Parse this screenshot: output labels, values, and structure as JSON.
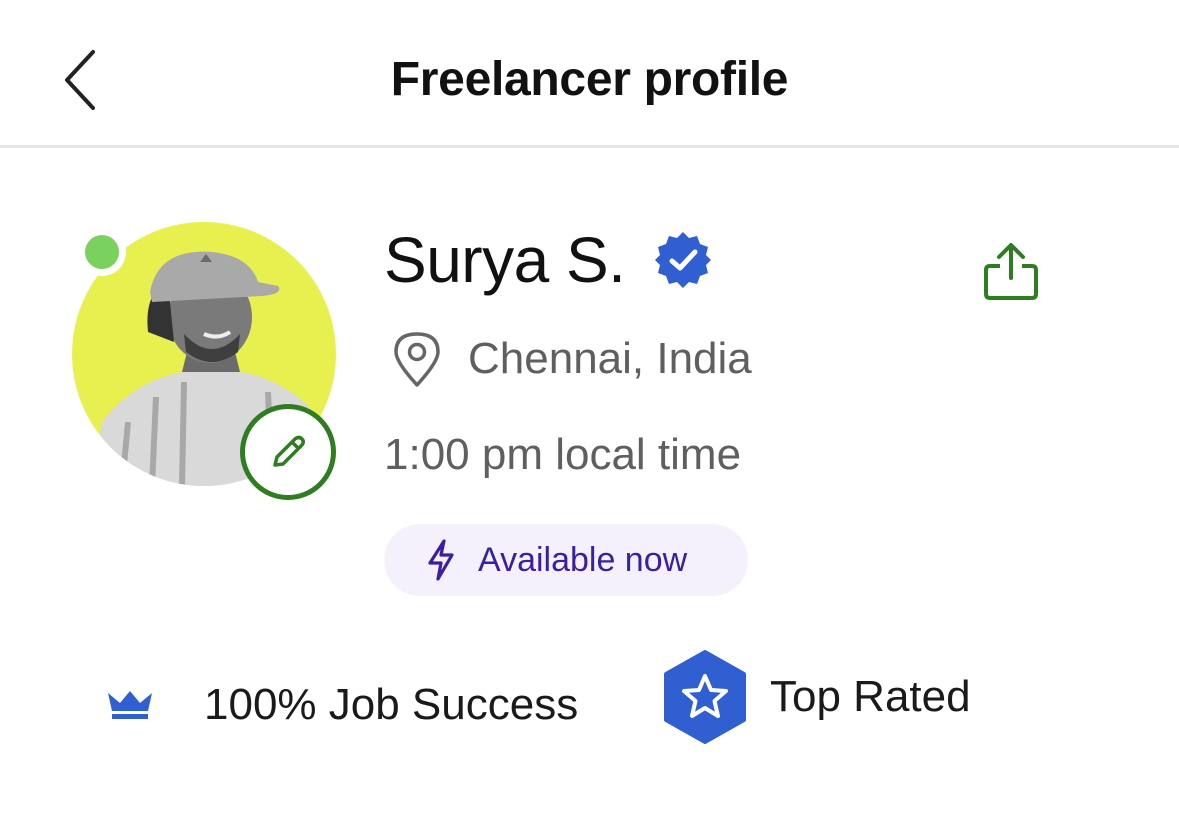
{
  "header": {
    "title": "Freelancer profile",
    "back_icon": "chevron-left-icon"
  },
  "profile": {
    "name": "Surya S.",
    "verified_icon": "verified-badge-icon",
    "location": "Chennai, India",
    "local_time": "1:00 pm local time",
    "availability": "Available now",
    "online": true
  },
  "stats": {
    "job_success": "100% Job Success",
    "top_rated": "Top Rated"
  },
  "colors": {
    "accent_green": "#2e7d21",
    "online_green": "#7bd15e",
    "avatar_bg": "#e8f04f",
    "badge_blue": "#2f5fd0",
    "availability_purple": "#3a1fa0",
    "availability_bg": "#f4f1fd"
  }
}
